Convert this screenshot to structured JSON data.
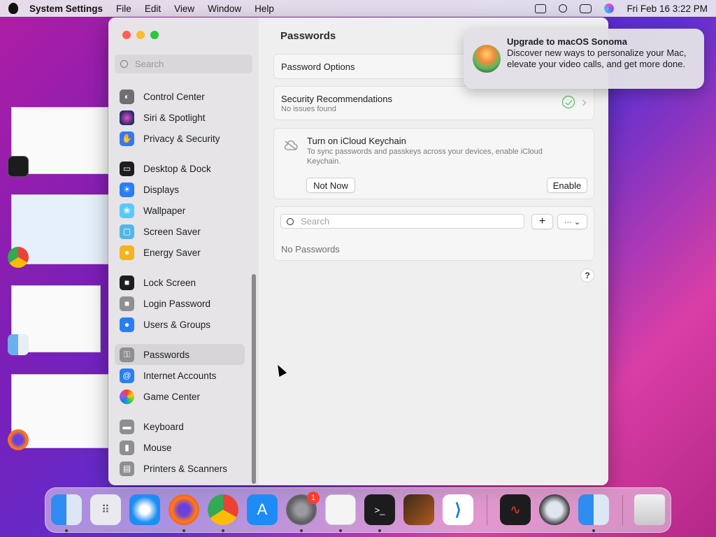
{
  "menubar": {
    "app_name": "System Settings",
    "items": [
      "File",
      "Edit",
      "View",
      "Window",
      "Help"
    ],
    "clock": "Fri Feb 16  3:22 PM"
  },
  "sidebar": {
    "search_placeholder": "Search",
    "items": [
      {
        "label": "Control Center",
        "icon": "control-center-icon",
        "color": "#6e6e73"
      },
      {
        "label": "Siri & Spotlight",
        "icon": "siri-icon",
        "color": "#2b2b66"
      },
      {
        "label": "Privacy & Security",
        "icon": "hand-icon",
        "color": "#3478f6"
      },
      {
        "label": "Desktop & Dock",
        "icon": "desktop-dock-icon",
        "color": "#1d1d1f"
      },
      {
        "label": "Displays",
        "icon": "displays-icon",
        "color": "#2a7ef5"
      },
      {
        "label": "Wallpaper",
        "icon": "wallpaper-icon",
        "color": "#5ac8fa"
      },
      {
        "label": "Screen Saver",
        "icon": "screen-saver-icon",
        "color": "#52b7e8"
      },
      {
        "label": "Energy Saver",
        "icon": "energy-saver-icon",
        "color": "#f5b31e"
      },
      {
        "label": "Lock Screen",
        "icon": "lock-icon",
        "color": "#1d1d1f"
      },
      {
        "label": "Login Password",
        "icon": "login-lock-icon",
        "color": "#8e8e93"
      },
      {
        "label": "Users & Groups",
        "icon": "users-icon",
        "color": "#2a7ef5"
      },
      {
        "label": "Passwords",
        "icon": "key-icon",
        "color": "#8e8e93"
      },
      {
        "label": "Internet Accounts",
        "icon": "at-icon",
        "color": "#2a7ef5"
      },
      {
        "label": "Game Center",
        "icon": "game-center-icon",
        "color": "#ffffff"
      },
      {
        "label": "Keyboard",
        "icon": "keyboard-icon",
        "color": "#8e8e93"
      },
      {
        "label": "Mouse",
        "icon": "mouse-icon",
        "color": "#8e8e93"
      },
      {
        "label": "Printers & Scanners",
        "icon": "printer-icon",
        "color": "#8e8e93"
      }
    ],
    "selected": "Passwords"
  },
  "content": {
    "title": "Passwords",
    "password_options": "Password Options",
    "security": {
      "label": "Security Recommendations",
      "status": "No issues found"
    },
    "keychain": {
      "title": "Turn on iCloud Keychain",
      "description": "To sync passwords and passkeys across your devices, enable iCloud Keychain.",
      "not_now": "Not Now",
      "enable": "Enable"
    },
    "search_placeholder": "Search",
    "add": "+",
    "more": "··· ⌄",
    "empty": "No Passwords",
    "help": "?"
  },
  "notification": {
    "title": "Upgrade to macOS Sonoma",
    "body": "Discover new ways to personalize your Mac, elevate your video calls, and get more done."
  },
  "dock": {
    "apps": [
      "finder-icon",
      "launchpad-icon",
      "safari-icon",
      "firefox-icon",
      "chrome-icon",
      "app-store-icon",
      "system-settings-icon",
      "textedit-icon",
      "terminal-icon",
      "garageband-icon",
      "vscode-icon",
      "voice-memos-icon",
      "quicktime-icon",
      "finder-icon",
      "trash-icon"
    ],
    "settings_badge": "1"
  }
}
